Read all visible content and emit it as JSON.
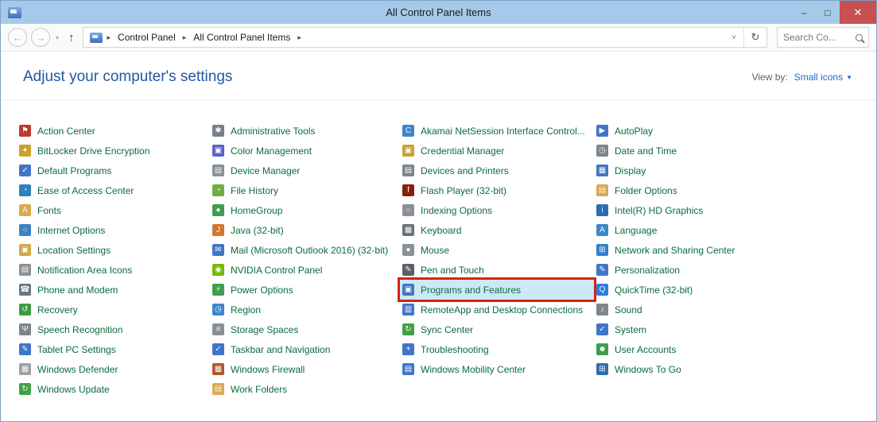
{
  "window": {
    "title": "All Control Panel Items",
    "controls": {
      "minimize": "–",
      "maximize": "□",
      "close": "✕"
    }
  },
  "navbar": {
    "back_glyph": "←",
    "forward_glyph": "→",
    "dropdown_glyph": "▾",
    "up_glyph": "↑",
    "breadcrumb": {
      "items": [
        "Control Panel",
        "All Control Panel Items"
      ],
      "separator": "▸"
    },
    "address_dropdown_glyph": "˅",
    "refresh_glyph": "↻",
    "search": {
      "placeholder": "Search Co..."
    }
  },
  "header": {
    "title": "Adjust your computer's settings",
    "view_by_label": "View by:",
    "view_by_value": "Small icons",
    "view_by_caret": "▼"
  },
  "colors": {
    "titlebar": "#a5c9e8",
    "close_button": "#c75050",
    "item_text": "#0b6b3c",
    "header_text": "#2456a5",
    "link_blue": "#2767c6",
    "highlight_background": "#cde9f7",
    "highlight_border": "#d62312"
  },
  "columns": [
    [
      {
        "label": "Action Center",
        "icon": "flag-icon",
        "color": "#c0392b",
        "glyph": "⚑"
      },
      {
        "label": "BitLocker Drive Encryption",
        "icon": "lock-icon",
        "color": "#c9a227",
        "glyph": "✦"
      },
      {
        "label": "Default Programs",
        "icon": "default-programs-icon",
        "color": "#3f76c9",
        "glyph": "✓"
      },
      {
        "label": "Ease of Access Center",
        "icon": "ease-of-access-clock-icon",
        "color": "#2e7fbe",
        "glyph": "◔"
      },
      {
        "label": "Fonts",
        "icon": "fonts-folder-icon",
        "color": "#dca94e",
        "glyph": "A"
      },
      {
        "label": "Internet Options",
        "icon": "internet-globe-icon",
        "color": "#3b82c4",
        "glyph": "○"
      },
      {
        "label": "Location Settings",
        "icon": "location-settings-icon",
        "color": "#d7a73f",
        "glyph": "▣"
      },
      {
        "label": "Notification Area Icons",
        "icon": "notification-monitor-icon",
        "color": "#8a9096",
        "glyph": "▤"
      },
      {
        "label": "Phone and Modem",
        "icon": "phone-icon",
        "color": "#6b7780",
        "glyph": "☎"
      },
      {
        "label": "Recovery",
        "icon": "recovery-icon",
        "color": "#3b9e3f",
        "glyph": "↺"
      },
      {
        "label": "Speech Recognition",
        "icon": "microphone-icon",
        "color": "#7d868c",
        "glyph": "Ψ"
      },
      {
        "label": "Tablet PC Settings",
        "icon": "tablet-pen-icon",
        "color": "#3f76c9",
        "glyph": "✎"
      },
      {
        "label": "Windows Defender",
        "icon": "defender-castle-icon",
        "color": "#9aa0a6",
        "glyph": "▦"
      },
      {
        "label": "Windows Update",
        "icon": "windows-update-icon",
        "color": "#43a047",
        "glyph": "↻"
      }
    ],
    [
      {
        "label": "Administrative Tools",
        "icon": "admin-tools-icon",
        "color": "#77808a",
        "glyph": "✱"
      },
      {
        "label": "Color Management",
        "icon": "color-management-icon",
        "color": "#5b5fc7",
        "glyph": "▣"
      },
      {
        "label": "Device Manager",
        "icon": "device-manager-icon",
        "color": "#8a9096",
        "glyph": "▤"
      },
      {
        "label": "File History",
        "icon": "file-history-icon",
        "color": "#6fae3f",
        "glyph": "◔"
      },
      {
        "label": "HomeGroup",
        "icon": "homegroup-icon",
        "color": "#3f9e4d",
        "glyph": "●"
      },
      {
        "label": "Java (32-bit)",
        "icon": "java-cup-icon",
        "color": "#d0762e",
        "glyph": "J"
      },
      {
        "label": "Mail (Microsoft Outlook 2016) (32-bit)",
        "icon": "mail-icon",
        "color": "#3f76c9",
        "glyph": "✉"
      },
      {
        "label": "NVIDIA Control Panel",
        "icon": "nvidia-icon",
        "color": "#76b900",
        "glyph": "◉"
      },
      {
        "label": "Power Options",
        "icon": "power-plug-icon",
        "color": "#3f9e4d",
        "glyph": "⚡"
      },
      {
        "label": "Region",
        "icon": "region-globe-icon",
        "color": "#3f86c9",
        "glyph": "◷"
      },
      {
        "label": "Storage Spaces",
        "icon": "storage-stack-icon",
        "color": "#8a9096",
        "glyph": "≡"
      },
      {
        "label": "Taskbar and Navigation",
        "icon": "taskbar-icon",
        "color": "#3f76c9",
        "glyph": "✓"
      },
      {
        "label": "Windows Firewall",
        "icon": "firewall-brick-icon",
        "color": "#b5552a",
        "glyph": "▦"
      },
      {
        "label": "Work Folders",
        "icon": "work-folders-icon",
        "color": "#dca94e",
        "glyph": "▤"
      }
    ],
    [
      {
        "label": "Akamai NetSession Interface Control...",
        "icon": "akamai-icon",
        "color": "#3f86c9",
        "glyph": "C"
      },
      {
        "label": "Credential Manager",
        "icon": "credential-vault-icon",
        "color": "#c9a227",
        "glyph": "▣"
      },
      {
        "label": "Devices and Printers",
        "icon": "printer-icon",
        "color": "#7d868c",
        "glyph": "▤"
      },
      {
        "label": "Flash Player (32-bit)",
        "icon": "flash-icon",
        "color": "#8a1f11",
        "glyph": "f"
      },
      {
        "label": "Indexing Options",
        "icon": "magnifier-icon",
        "color": "#8a9096",
        "glyph": "○"
      },
      {
        "label": "Keyboard",
        "icon": "keyboard-icon",
        "color": "#6b7076",
        "glyph": "▦"
      },
      {
        "label": "Mouse",
        "icon": "mouse-icon",
        "color": "#8a9096",
        "glyph": "●"
      },
      {
        "label": "Pen and Touch",
        "icon": "pen-icon",
        "color": "#5a6066",
        "glyph": "✎"
      },
      {
        "label": "Programs and Features",
        "icon": "programs-features-icon",
        "color": "#3f76c9",
        "glyph": "▣",
        "highlighted": true
      },
      {
        "label": "RemoteApp and Desktop Connections",
        "icon": "remoteapp-icon",
        "color": "#3f76c9",
        "glyph": "▥"
      },
      {
        "label": "Sync Center",
        "icon": "sync-icon",
        "color": "#43a047",
        "glyph": "↻"
      },
      {
        "label": "Troubleshooting",
        "icon": "troubleshooting-icon",
        "color": "#3f76c9",
        "glyph": "+"
      },
      {
        "label": "Windows Mobility Center",
        "icon": "mobility-center-icon",
        "color": "#3f76c9",
        "glyph": "▤"
      }
    ],
    [
      {
        "label": "AutoPlay",
        "icon": "autoplay-icon",
        "color": "#3f76c9",
        "glyph": "▶"
      },
      {
        "label": "Date and Time",
        "icon": "date-time-icon",
        "color": "#7d868c",
        "glyph": "◷"
      },
      {
        "label": "Display",
        "icon": "display-icon",
        "color": "#3f76c9",
        "glyph": "▦"
      },
      {
        "label": "Folder Options",
        "icon": "folder-options-icon",
        "color": "#dca94e",
        "glyph": "▤"
      },
      {
        "label": "Intel(R) HD Graphics",
        "icon": "intel-graphics-icon",
        "color": "#2a6db5",
        "glyph": "i"
      },
      {
        "label": "Language",
        "icon": "language-globe-icon",
        "color": "#3f86c9",
        "glyph": "A"
      },
      {
        "label": "Network and Sharing Center",
        "icon": "network-icon",
        "color": "#2f7fd0",
        "glyph": "⊞"
      },
      {
        "label": "Personalization",
        "icon": "personalization-icon",
        "color": "#3f76c9",
        "glyph": "✎"
      },
      {
        "label": "QuickTime (32-bit)",
        "icon": "quicktime-icon",
        "color": "#2a7de1",
        "glyph": "Q"
      },
      {
        "label": "Sound",
        "icon": "sound-speaker-icon",
        "color": "#7d868c",
        "glyph": "♪"
      },
      {
        "label": "System",
        "icon": "system-icon",
        "color": "#3f76c9",
        "glyph": "✓"
      },
      {
        "label": "User Accounts",
        "icon": "user-accounts-icon",
        "color": "#3f9e4d",
        "glyph": "☻"
      },
      {
        "label": "Windows To Go",
        "icon": "windows-to-go-icon",
        "color": "#2a6db5",
        "glyph": "⊞"
      }
    ]
  ]
}
